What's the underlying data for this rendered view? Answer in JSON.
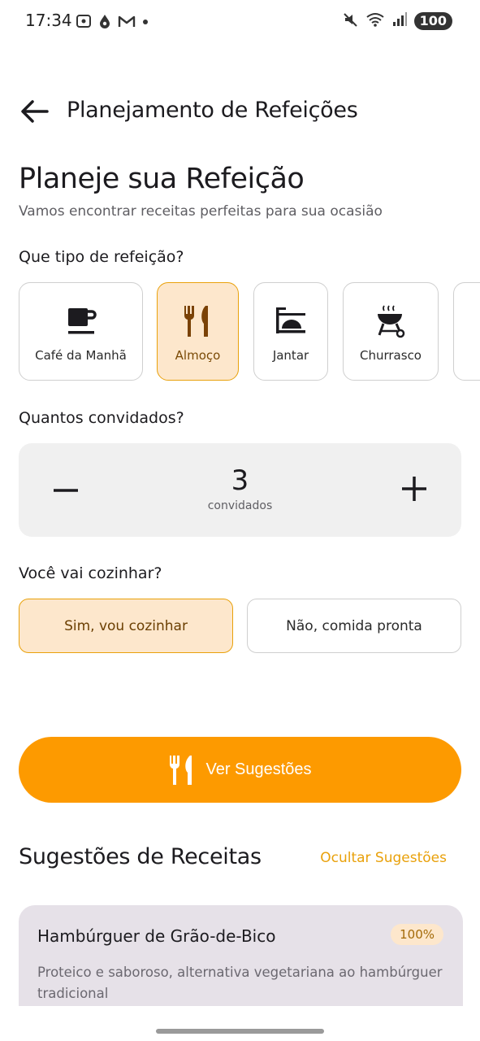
{
  "status_bar": {
    "time": "17:34",
    "battery": "100",
    "left_icons": [
      "screenshot-icon",
      "drop-icon",
      "gmail-icon",
      "dot-icon"
    ],
    "right_icons": [
      "mute-icon",
      "wifi-icon",
      "signal-icon"
    ]
  },
  "top_bar": {
    "title": "Planejamento de Refeições",
    "back_icon": "arrow-back-icon"
  },
  "heading": {
    "title": "Planeje sua Refeição",
    "subtitle": "Vamos encontrar receitas perfeitas para sua ocasião"
  },
  "meal_type": {
    "label": "Que tipo de refeição?",
    "options": [
      {
        "label": "Café da Manhã",
        "icon": "coffee-cup-icon",
        "selected": false
      },
      {
        "label": "Almoço",
        "icon": "fork-knife-icon",
        "selected": true
      },
      {
        "label": "Jantar",
        "icon": "dinner-tray-icon",
        "selected": false
      },
      {
        "label": "Churrasco",
        "icon": "grill-icon",
        "selected": false
      }
    ]
  },
  "guests": {
    "label": "Quantos convidados?",
    "count": "3",
    "unit": "convidados"
  },
  "cooking": {
    "label": "Você vai cozinhar?",
    "yes": "Sim, vou cozinhar",
    "no": "Não, comida pronta",
    "selected": "yes"
  },
  "cta": {
    "label": "Ver Sugestões",
    "icon": "restaurant-icon"
  },
  "suggestions": {
    "title": "Sugestões de Receitas",
    "hide_label": "Ocultar Sugestões",
    "recipes": [
      {
        "name": "Hambúrguer de Grão-de-Bico",
        "match": "100%",
        "description": "Proteico e saboroso, alternativa vegetariana ao hambúrguer tradicional"
      }
    ]
  },
  "colors": {
    "accent": "#fd9a00",
    "selected_bg": "#fde7cc",
    "selected_border": "#e9a10b",
    "card_bg": "#e6e1e8"
  }
}
